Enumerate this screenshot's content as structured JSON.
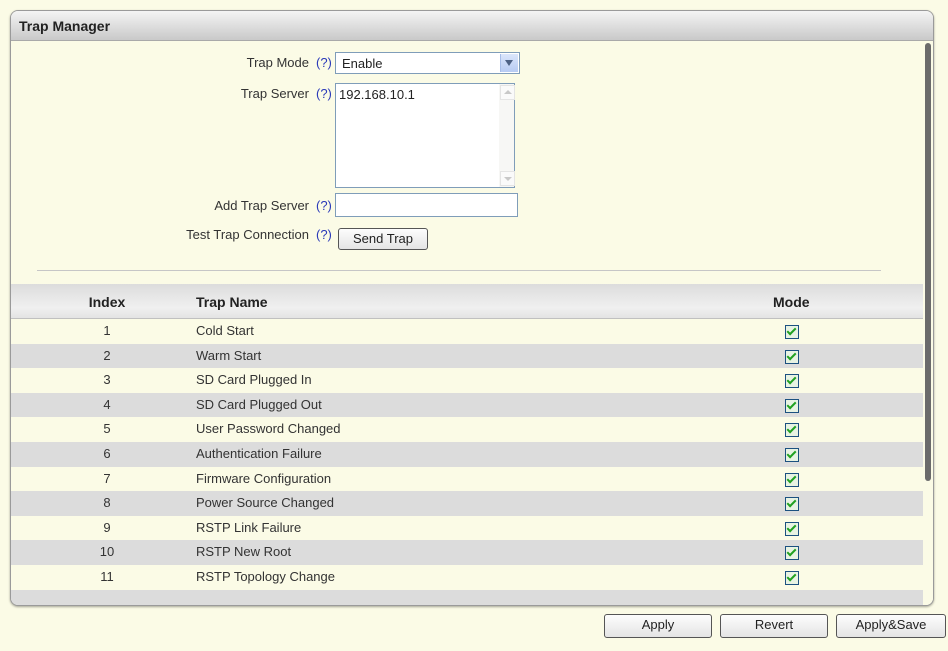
{
  "panel": {
    "title": "Trap Manager"
  },
  "form": {
    "help": "(?)",
    "trap_mode": {
      "label": "Trap Mode",
      "value": "Enable"
    },
    "trap_server": {
      "label": "Trap Server",
      "items": [
        "192.168.10.1"
      ]
    },
    "add_trap_server": {
      "label": "Add Trap Server",
      "value": ""
    },
    "test_trap": {
      "label": "Test Trap Connection",
      "button": "Send Trap"
    }
  },
  "table": {
    "headers": {
      "index": "Index",
      "name": "Trap Name",
      "mode": "Mode"
    },
    "rows": [
      {
        "index": "1",
        "name": "Cold Start",
        "mode": true
      },
      {
        "index": "2",
        "name": "Warm Start",
        "mode": true
      },
      {
        "index": "3",
        "name": "SD Card Plugged In",
        "mode": true
      },
      {
        "index": "4",
        "name": "SD Card Plugged Out",
        "mode": true
      },
      {
        "index": "5",
        "name": "User Password Changed",
        "mode": true
      },
      {
        "index": "6",
        "name": "Authentication Failure",
        "mode": true
      },
      {
        "index": "7",
        "name": "Firmware Configuration",
        "mode": true
      },
      {
        "index": "8",
        "name": "Power Source Changed",
        "mode": true
      },
      {
        "index": "9",
        "name": "RSTP Link Failure",
        "mode": true
      },
      {
        "index": "10",
        "name": "RSTP New Root",
        "mode": true
      },
      {
        "index": "11",
        "name": "RSTP Topology Change",
        "mode": true
      }
    ]
  },
  "footer": {
    "apply": "Apply",
    "revert": "Revert",
    "apply_save": "Apply&Save"
  },
  "colors": {
    "background": "#fbfbe6",
    "help_link": "#2a39b9",
    "checkbox_check": "#21a121"
  },
  "icons": {
    "select_arrow": "chevron-down-icon",
    "checkbox": "checkbox-checked-icon"
  }
}
